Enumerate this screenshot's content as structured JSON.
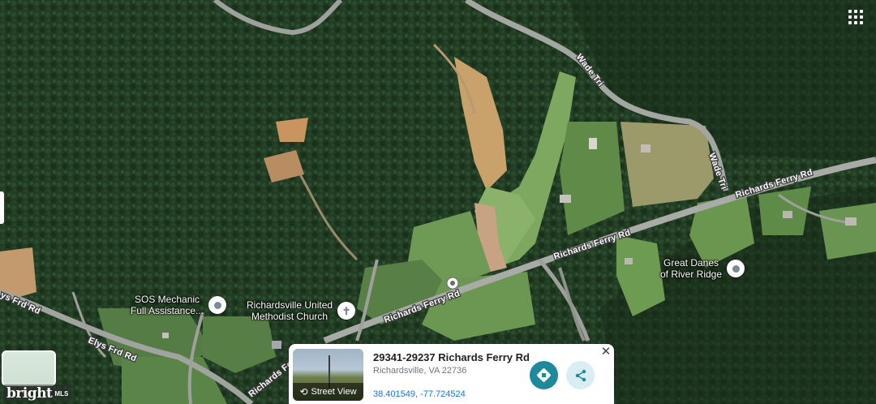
{
  "roads": {
    "wade_tri_1": "Wade Tri",
    "wade_tri_2": "Wade Tri",
    "richards_ferry_1": "Richards Ferry Rd",
    "richards_ferry_2": "Richards Ferry Rd",
    "richards_ferry_3": "Richards Ferry Rd",
    "richards_ferry_4": "Richards Fe",
    "elys_frd_1": "Elys Frd Rd",
    "elys_frd_2": "ys Frd Rd"
  },
  "places": [
    {
      "name_line1": "SOS Mechanic",
      "name_line2": "Full Assistance...",
      "icon": "location-pin-icon"
    },
    {
      "name_line1": "Richardsville United",
      "name_line2": "Methodist Church",
      "icon": "church-pin-icon"
    },
    {
      "name_line1": "Great Danes",
      "name_line2": "of River Ridge",
      "icon": "location-pin-icon"
    }
  ],
  "info_card": {
    "title": "29341-29237 Richards Ferry Rd",
    "subtitle": "Richardsville, VA 22736",
    "coordinates": "38.401549, -77.724524",
    "street_view_label": "Street View",
    "accent_color": "#1a8a9c"
  },
  "watermark": {
    "brand": "bright",
    "sub": "MLS"
  },
  "colors": {
    "forest_dark": "#1f3a22",
    "field_green": "#6f9a55",
    "dirt": "#c9a16b"
  }
}
